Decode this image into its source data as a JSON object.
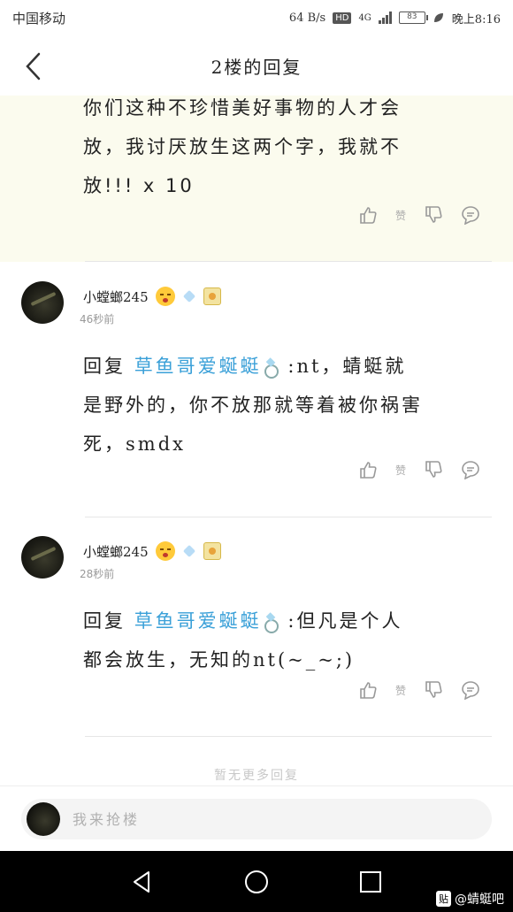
{
  "status_bar": {
    "carrier": "中国移动",
    "speed": "64 B/s",
    "hd": "HD",
    "network": "4G",
    "battery": "83",
    "time": "晚上8:16"
  },
  "header": {
    "title": "2楼的回复"
  },
  "highlight_post": {
    "lines": [
      "你们这种不珍惜美好事物的人才会",
      "放，我讨厌放生这两个字，我就不",
      "放!!! x 10"
    ],
    "dislike_label": "赞"
  },
  "replies": [
    {
      "username": "小螳螂245",
      "time": "46秒前",
      "prefix": "回复",
      "mention": "草鱼哥爱蜒蜓",
      "line1_rest": ":nt，蜻蜓就",
      "line2": "是野外的，你不放那就等着被你祸害",
      "line3": "死，smdx",
      "dislike_label": "赞"
    },
    {
      "username": "小螳螂245",
      "time": "28秒前",
      "prefix": "回复",
      "mention": "草鱼哥爱蜒蜓",
      "line1_rest": ":但凡是个人",
      "line2": "都会放生，无知的nt(~_~;)",
      "dislike_label": "赞"
    }
  ],
  "no_more_text": "暂无更多回复",
  "reply_input": {
    "placeholder": "我来抢楼"
  },
  "watermark": {
    "logo": "贴",
    "text": "@蜻蜓吧"
  },
  "colors": {
    "mention": "#3aa0d8",
    "highlight_bg": "#fbfbee"
  }
}
